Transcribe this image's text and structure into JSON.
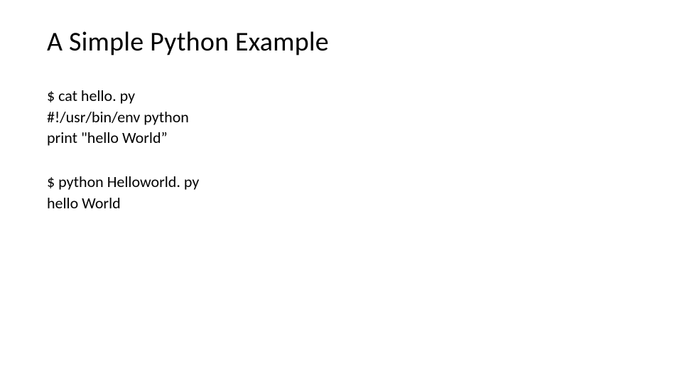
{
  "title": "A Simple Python Example",
  "block1": {
    "line1": "$ cat hello. py",
    "line2": "#!/usr/bin/env python",
    "line3": "print \"hello World”"
  },
  "block2": {
    "line1": "$ python Helloworld. py",
    "line2": "hello World"
  }
}
